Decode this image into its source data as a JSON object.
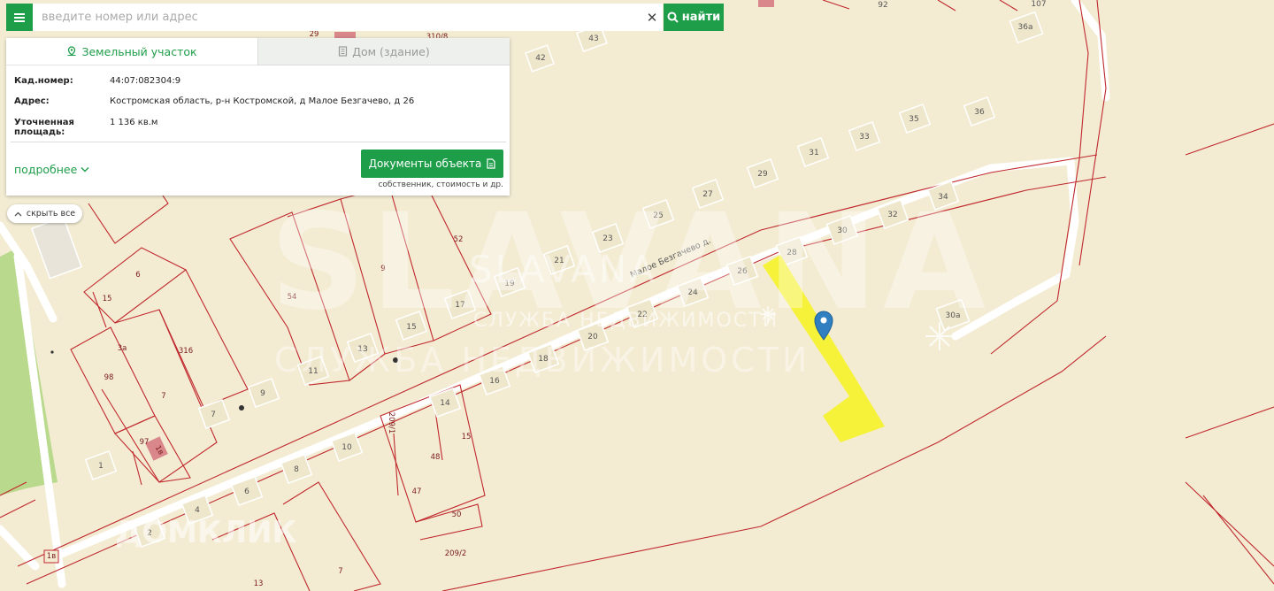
{
  "search": {
    "placeholder": "введите номер или адрес",
    "clear_glyph": "✕",
    "find_label": "найти"
  },
  "tabs": [
    {
      "label": "Земельный участок",
      "icon": "location-icon",
      "active": true
    },
    {
      "label": "Дом (здание)",
      "icon": "building-icon",
      "active": false
    }
  ],
  "parcel": {
    "cad_label": "Кад.номер:",
    "cad_value": "44:07:082304:9",
    "address_label": "Адрес:",
    "address_value": "Костромская область, р-н Костромской, д Малое Безгачево, д 26",
    "area_label_1": "Уточненная",
    "area_label_2": "площадь:",
    "area_value": "1 136 кв.м"
  },
  "actions": {
    "more_label": "подробнее",
    "docs_label": "Документы объекта",
    "docs_sub": "собственник, стоимость и др.",
    "hide_all_label": "скрыть все"
  },
  "map": {
    "street_label": "Малое Безгачево д.",
    "watermark_big": "SLAVANA",
    "watermark_mid": "SLAVANA",
    "watermark_sub1": "СЛУЖБА НЕДВИЖИМОСТИ",
    "watermark_sub2": "СЛУЖБА НЕДВИЖИМОСТИ",
    "watermark_dom": "ДОМКЛИК",
    "colors": {
      "background": "#f3ecd3",
      "boundary": "#c0282d",
      "road": "#ffffff",
      "highlight": "#f5f230",
      "marker": "#2f7fc1",
      "green": "#b9d98c",
      "accent": "#1f9e4a"
    },
    "house_numbers": [
      "92",
      "107",
      "36а",
      "43",
      "42",
      "35",
      "36",
      "33",
      "31",
      "29",
      "27",
      "25",
      "23",
      "21",
      "19",
      "17",
      "15",
      "13",
      "11",
      "9",
      "7",
      "34",
      "32",
      "30",
      "30а",
      "28",
      "26",
      "24",
      "22",
      "20",
      "18",
      "16",
      "14",
      "10",
      "8",
      "6",
      "4",
      "1",
      "2"
    ],
    "parcel_numbers": [
      "29",
      "310/8",
      "52",
      "9",
      "54",
      "6",
      "15",
      "316",
      "3а",
      "98",
      "7",
      "97",
      "209/1",
      "15",
      "48",
      "47",
      "50",
      "209/2",
      "7",
      "13",
      "1в",
      "1в"
    ]
  }
}
